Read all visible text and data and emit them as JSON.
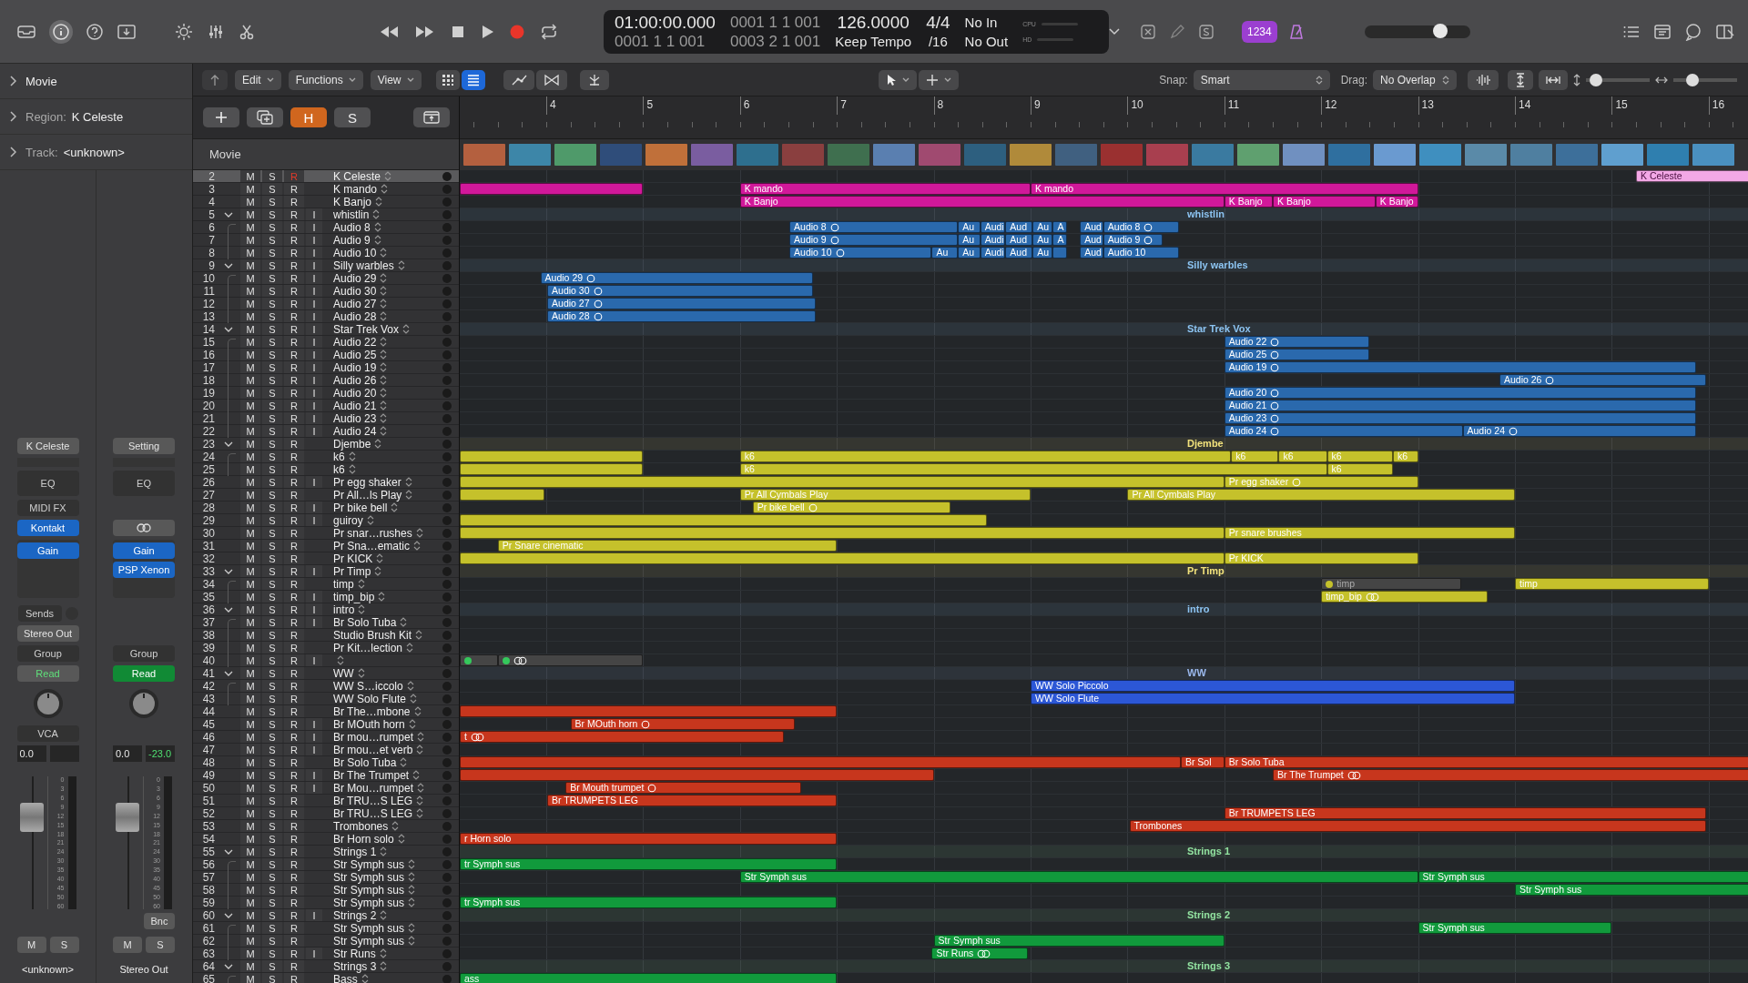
{
  "top_bar": {
    "inspector_button": {
      "selected": true
    },
    "lcd": {
      "time": "01:00:00.000",
      "position_top": "0001 1 1 001",
      "position": "0001 1 1 001",
      "length": "0003 2 1 001",
      "tempo": "126.0000",
      "tempo_mode": "Keep Tempo",
      "signature": "4/4",
      "division": "/16",
      "midi_in": "No In",
      "midi_out": "No Out",
      "cpu_label": "CPU",
      "hd_label": "HD"
    },
    "count_in": "1234",
    "master_volume": {
      "level": 0.72
    }
  },
  "toolbar": {
    "menus": [
      "Edit",
      "Functions",
      "View"
    ],
    "view_modes": [
      {
        "selected": false
      },
      {
        "selected": true
      }
    ],
    "snap_label": "Snap:",
    "snap": "Smart",
    "drag_label": "Drag:",
    "drag": "No Overlap",
    "vertical_zoom": {
      "level": 0.15
    },
    "horizontal_zoom": {
      "level": 0.3
    }
  },
  "inspector": {
    "sections": [
      {
        "label": "Movie"
      },
      {
        "label": "Region:",
        "value": "K Celeste"
      },
      {
        "label": "Track:",
        "value": "<unknown>"
      }
    ],
    "strips": [
      {
        "setting": "K Celeste",
        "eq": "EQ",
        "midi_fx": "MIDI FX",
        "plugins": [
          "Kontakt",
          "Gain"
        ],
        "sends": "Sends",
        "output": "Stereo Out",
        "group": "Group",
        "automation": "Read",
        "automation_on": false,
        "vca": "VCA",
        "volume": "0.0",
        "fader": {
          "level": 0.75
        },
        "scale": [
          "0",
          "3",
          "6",
          "9",
          "12",
          "15",
          "18",
          "21",
          "24",
          "30",
          "35",
          "40",
          "45",
          "50",
          "60"
        ],
        "mute": "M",
        "solo": "S",
        "name": "<unknown>"
      },
      {
        "setting": "Setting",
        "eq": "EQ",
        "link": true,
        "plugins": [
          "Gain",
          "PSP Xenon"
        ],
        "group": "Group",
        "automation": "Read",
        "automation_on": true,
        "volume": "0.0",
        "peak": "-23.0",
        "fader": {
          "level": 0.75
        },
        "scale": [
          "0",
          "3",
          "6",
          "9",
          "12",
          "15",
          "18",
          "21",
          "24",
          "30",
          "35",
          "40",
          "45",
          "50",
          "60"
        ],
        "bounce": "Bnc",
        "mute": "M",
        "solo": "S",
        "name": "Stereo Out"
      }
    ]
  },
  "track_list": {
    "buttons": [
      {
        "label": "H",
        "selected": true
      },
      {
        "label": "S",
        "selected": false
      }
    ],
    "movie_label": "Movie"
  },
  "ruler": [
    "4",
    "5",
    "6",
    "7",
    "8",
    "9",
    "10",
    "11",
    "12",
    "13",
    "14",
    "15",
    "16"
  ],
  "tracks": [
    {
      "number": "2",
      "name": "K Celeste",
      "kind": "track",
      "buttons": [
        "M",
        "S",
        "R"
      ],
      "armed": true,
      "selected": true,
      "color": "#f3a8e6",
      "regions": [
        {
          "label": "K Celeste",
          "muted": false
        }
      ]
    },
    {
      "number": "3",
      "name": "K mando",
      "kind": "track",
      "buttons": [
        "M",
        "S",
        "R"
      ],
      "armed": false,
      "selected": false,
      "color": "#d1189a",
      "regions": [
        {
          "muted": false
        },
        {
          "label": "K mando",
          "muted": false
        },
        {
          "label": "K mando",
          "muted": false
        }
      ]
    },
    {
      "number": "4",
      "name": "K Banjo",
      "kind": "track",
      "buttons": [
        "M",
        "S",
        "R"
      ],
      "armed": false,
      "selected": false,
      "color": "#d1189a",
      "regions": [
        {
          "label": "K Banjo",
          "muted": false
        },
        {
          "label": "K Banjo",
          "muted": false
        },
        {
          "label": "K Banjo",
          "muted": false
        },
        {
          "label": "K Banjo",
          "muted": false
        }
      ]
    },
    {
      "number": "5",
      "name": "whistlin",
      "kind": "folder",
      "expanded": true,
      "summary": "whistlin",
      "buttons": [
        "M",
        "S",
        "R",
        "I"
      ],
      "armed": false,
      "selected": false,
      "color": "#8cc4f2",
      "children": [
        {
          "number": "6",
          "name": "Audio 8",
          "kind": "track",
          "buttons": [
            "M",
            "S",
            "R",
            "I"
          ],
          "armed": false,
          "selected": false,
          "color": "#2a69ad",
          "regions": [
            {
              "label": "Audio 8",
              "kind": "ring",
              "muted": false
            },
            {
              "label": "Au",
              "muted": false
            },
            {
              "label": "Audi",
              "muted": false
            },
            {
              "label": "Aud",
              "muted": false
            },
            {
              "label": "Au",
              "muted": false
            },
            {
              "label": "A",
              "muted": false
            },
            {
              "label": "Aud",
              "muted": false
            },
            {
              "label": "Audio 8",
              "kind": "ring",
              "muted": false
            }
          ]
        },
        {
          "number": "7",
          "name": "Audio 9",
          "kind": "track",
          "buttons": [
            "M",
            "S",
            "R",
            "I"
          ],
          "armed": false,
          "selected": false,
          "color": "#2a69ad",
          "regions": [
            {
              "label": "Audio 9",
              "kind": "ring",
              "muted": false
            },
            {
              "label": "Au",
              "muted": false
            },
            {
              "label": "Audi",
              "muted": false
            },
            {
              "label": "Aud",
              "muted": false
            },
            {
              "label": "Au",
              "muted": false
            },
            {
              "label": "A",
              "muted": false
            },
            {
              "label": "Aud",
              "muted": false
            },
            {
              "label": "Audio 9",
              "kind": "ring",
              "muted": false
            }
          ]
        },
        {
          "number": "8",
          "name": "Audio 10",
          "kind": "track",
          "buttons": [
            "M",
            "S",
            "R",
            "I"
          ],
          "armed": false,
          "selected": false,
          "color": "#2a69ad",
          "regions": [
            {
              "label": "Audio 10",
              "kind": "ring",
              "muted": false
            },
            {
              "label": "Au",
              "muted": false
            },
            {
              "label": "Au",
              "muted": false
            },
            {
              "label": "Audi",
              "muted": false
            },
            {
              "label": "Aud",
              "muted": false
            },
            {
              "label": "Au",
              "muted": false
            },
            {
              "muted": false
            },
            {
              "label": "Aud",
              "muted": false
            },
            {
              "label": "Audio 10",
              "muted": false
            }
          ]
        }
      ]
    },
    {
      "number": "9",
      "name": "Silly warbles",
      "kind": "folder",
      "expanded": true,
      "summary": "Silly warbles",
      "buttons": [
        "M",
        "S",
        "R",
        "I"
      ],
      "armed": false,
      "selected": false,
      "color": "#8cc4f2",
      "children": [
        {
          "number": "10",
          "name": "Audio 29",
          "kind": "track",
          "buttons": [
            "M",
            "S",
            "R",
            "I"
          ],
          "armed": false,
          "selected": false,
          "color": "#2a69ad",
          "regions": [
            {
              "label": "Audio 29",
              "kind": "ring",
              "muted": false
            }
          ]
        },
        {
          "number": "11",
          "name": "Audio 30",
          "kind": "track",
          "buttons": [
            "M",
            "S",
            "R",
            "I"
          ],
          "armed": false,
          "selected": false,
          "color": "#2a69ad",
          "regions": [
            {
              "label": "Audio 30",
              "kind": "ring",
              "muted": false
            }
          ]
        },
        {
          "number": "12",
          "name": "Audio 27",
          "kind": "track",
          "buttons": [
            "M",
            "S",
            "R",
            "I"
          ],
          "armed": false,
          "selected": false,
          "color": "#2a69ad",
          "regions": [
            {
              "label": "Audio 27",
              "kind": "ring",
              "muted": false
            }
          ]
        },
        {
          "number": "13",
          "name": "Audio 28",
          "kind": "track",
          "buttons": [
            "M",
            "S",
            "R",
            "I"
          ],
          "armed": false,
          "selected": false,
          "color": "#2a69ad",
          "regions": [
            {
              "label": "Audio 28",
              "kind": "ring",
              "muted": false
            }
          ]
        }
      ]
    },
    {
      "number": "14",
      "name": "Star Trek Vox",
      "kind": "folder",
      "expanded": true,
      "summary": "Star Trek Vox",
      "buttons": [
        "M",
        "S",
        "R",
        "I"
      ],
      "armed": false,
      "selected": false,
      "color": "#8cc4f2",
      "children": [
        {
          "number": "15",
          "name": "Audio 22",
          "kind": "track",
          "buttons": [
            "M",
            "S",
            "R",
            "I"
          ],
          "armed": false,
          "selected": false,
          "color": "#2a69ad",
          "regions": [
            {
              "label": "Audio 22",
              "kind": "ring",
              "muted": false
            }
          ]
        },
        {
          "number": "16",
          "name": "Audio 25",
          "kind": "track",
          "buttons": [
            "M",
            "S",
            "R",
            "I"
          ],
          "armed": false,
          "selected": false,
          "color": "#2a69ad",
          "regions": [
            {
              "label": "Audio 25",
              "kind": "ring",
              "muted": false
            }
          ]
        },
        {
          "number": "17",
          "name": "Audio 19",
          "kind": "track",
          "buttons": [
            "M",
            "S",
            "R",
            "I"
          ],
          "armed": false,
          "selected": false,
          "color": "#2a69ad",
          "regions": [
            {
              "label": "Audio 19",
              "kind": "ring",
              "muted": false
            }
          ]
        },
        {
          "number": "18",
          "name": "Audio 26",
          "kind": "track",
          "buttons": [
            "M",
            "S",
            "R",
            "I"
          ],
          "armed": false,
          "selected": false,
          "color": "#2a69ad",
          "regions": [
            {
              "label": "Audio 26",
              "kind": "ring",
              "muted": false
            }
          ]
        },
        {
          "number": "19",
          "name": "Audio 20",
          "kind": "track",
          "buttons": [
            "M",
            "S",
            "R",
            "I"
          ],
          "armed": false,
          "selected": false,
          "color": "#2a69ad",
          "regions": [
            {
              "label": "Audio 20",
              "kind": "ring",
              "muted": false
            }
          ]
        },
        {
          "number": "20",
          "name": "Audio 21",
          "kind": "track",
          "buttons": [
            "M",
            "S",
            "R",
            "I"
          ],
          "armed": false,
          "selected": false,
          "color": "#2a69ad",
          "regions": [
            {
              "label": "Audio 21",
              "kind": "ring",
              "muted": false
            }
          ]
        },
        {
          "number": "21",
          "name": "Audio 23",
          "kind": "track",
          "buttons": [
            "M",
            "S",
            "R",
            "I"
          ],
          "armed": false,
          "selected": false,
          "color": "#2a69ad",
          "regions": [
            {
              "label": "Audio 23",
              "kind": "ring",
              "muted": false
            }
          ]
        },
        {
          "number": "22",
          "name": "Audio 24",
          "kind": "track",
          "buttons": [
            "M",
            "S",
            "R",
            "I"
          ],
          "armed": false,
          "selected": false,
          "color": "#2a69ad",
          "regions": [
            {
              "label": "Audio 24",
              "kind": "ring",
              "muted": false
            },
            {
              "label": "Audio 24",
              "kind": "ring",
              "muted": false
            }
          ]
        }
      ]
    },
    {
      "number": "23",
      "name": "Djembe",
      "kind": "folder",
      "expanded": true,
      "summary": "Djembe",
      "buttons": [
        "M",
        "S",
        "R"
      ],
      "armed": false,
      "selected": false,
      "color": "#f2e27c",
      "children": [
        {
          "number": "24",
          "name": "k6",
          "kind": "track",
          "buttons": [
            "M",
            "S",
            "R"
          ],
          "armed": false,
          "selected": false,
          "color": "#c5c12b",
          "regions": [
            {
              "muted": false
            },
            {
              "label": "k6",
              "muted": false
            },
            {
              "label": "k6",
              "muted": false
            },
            {
              "label": "k6",
              "muted": false
            },
            {
              "label": "k6",
              "muted": false
            },
            {
              "label": "k6",
              "muted": false
            }
          ]
        },
        {
          "number": "25",
          "name": "k6",
          "kind": "track",
          "buttons": [
            "M",
            "S",
            "R"
          ],
          "armed": false,
          "selected": false,
          "color": "#c5c12b",
          "regions": [
            {
              "muted": false
            },
            {
              "label": "k6",
              "muted": false
            },
            {
              "label": "k6",
              "muted": false
            }
          ]
        }
      ]
    },
    {
      "number": "26",
      "name": "Pr egg shaker",
      "kind": "track",
      "buttons": [
        "M",
        "S",
        "R",
        "I"
      ],
      "armed": false,
      "selected": false,
      "color": "#c5c12b",
      "regions": [
        {
          "muted": false
        },
        {
          "label": "Pr egg shaker",
          "kind": "ring",
          "muted": false
        }
      ]
    },
    {
      "number": "27",
      "name": "Pr All…ls Play",
      "kind": "track",
      "buttons": [
        "M",
        "S",
        "R"
      ],
      "armed": false,
      "selected": false,
      "color": "#c5c12b",
      "regions": [
        {
          "muted": false
        },
        {
          "label": "Pr All Cymbals Play",
          "muted": false
        },
        {
          "label": "Pr All Cymbals Play",
          "muted": false
        }
      ]
    },
    {
      "number": "28",
      "name": "Pr bike bell",
      "kind": "track",
      "buttons": [
        "M",
        "S",
        "R",
        "I"
      ],
      "armed": false,
      "selected": false,
      "color": "#c5c12b",
      "regions": [
        {
          "label": "Pr bike bell",
          "kind": "ring",
          "muted": false
        }
      ]
    },
    {
      "number": "29",
      "name": "guiroy",
      "kind": "track",
      "buttons": [
        "M",
        "S",
        "R",
        "I"
      ],
      "armed": false,
      "selected": false,
      "color": "#c5c12b",
      "regions": [
        {
          "muted": false
        }
      ]
    },
    {
      "number": "30",
      "name": "Pr snar…rushes",
      "kind": "track",
      "buttons": [
        "M",
        "S",
        "R"
      ],
      "armed": false,
      "selected": false,
      "color": "#c5c12b",
      "regions": [
        {
          "muted": false
        },
        {
          "label": "Pr snare brushes",
          "muted": false
        }
      ]
    },
    {
      "number": "31",
      "name": "Pr Sna…ematic",
      "kind": "track",
      "buttons": [
        "M",
        "S",
        "R"
      ],
      "armed": false,
      "selected": false,
      "color": "#c5c12b",
      "regions": [
        {
          "label": "Pr Snare cinematic",
          "muted": false
        }
      ]
    },
    {
      "number": "32",
      "name": "Pr KICK",
      "kind": "track",
      "buttons": [
        "M",
        "S",
        "R"
      ],
      "armed": false,
      "selected": false,
      "color": "#c5c12b",
      "regions": [
        {
          "muted": false
        },
        {
          "label": "Pr KICK",
          "muted": false
        }
      ]
    },
    {
      "number": "33",
      "name": "Pr Timp",
      "kind": "folder",
      "expanded": true,
      "summary": "Pr Timp",
      "buttons": [
        "M",
        "S",
        "R",
        "I"
      ],
      "armed": false,
      "selected": false,
      "color": "#f2e27c",
      "children": [
        {
          "number": "34",
          "name": "timp",
          "kind": "track",
          "buttons": [
            "M",
            "S",
            "R"
          ],
          "armed": false,
          "selected": false,
          "color": "#c5c12b",
          "regions": [
            {
              "label": "timp",
              "muted": true
            },
            {
              "label": "timp",
              "muted": false
            }
          ]
        },
        {
          "number": "35",
          "name": "timp_bip",
          "kind": "track",
          "buttons": [
            "M",
            "S",
            "R",
            "I"
          ],
          "armed": false,
          "selected": false,
          "color": "#c5c12b",
          "regions": [
            {
              "label": "timp_bip",
              "kind": "rings",
              "muted": false
            }
          ]
        }
      ]
    },
    {
      "number": "36",
      "name": "intro",
      "kind": "folder",
      "expanded": true,
      "summary": "intro",
      "buttons": [
        "M",
        "S",
        "R",
        "I"
      ],
      "armed": false,
      "selected": false,
      "color": "#8cc4f2",
      "children": [
        {
          "number": "37",
          "name": "Br Solo Tuba",
          "kind": "track",
          "buttons": [
            "M",
            "S",
            "R",
            "I"
          ],
          "armed": false,
          "selected": false
        },
        {
          "number": "38",
          "name": "Studio Brush Kit",
          "kind": "track",
          "buttons": [
            "M",
            "S",
            "R"
          ],
          "armed": false,
          "selected": false
        },
        {
          "number": "39",
          "name": "Pr Kit…lection",
          "kind": "track",
          "buttons": [
            "M",
            "S",
            "R"
          ],
          "armed": false,
          "selected": false
        },
        {
          "number": "40",
          "kind": "track",
          "buttons": [
            "M",
            "S",
            "R",
            "I"
          ],
          "armed": false,
          "selected": false,
          "color": "#35c85c",
          "regions": [
            {
              "muted": true
            },
            {
              "kind": "rings",
              "muted": true
            }
          ]
        }
      ]
    },
    {
      "number": "41",
      "name": "WW",
      "kind": "folder",
      "expanded": true,
      "summary": "WW",
      "buttons": [
        "M",
        "S",
        "R"
      ],
      "armed": false,
      "selected": false,
      "color": "#9ab8ec",
      "children": [
        {
          "number": "42",
          "name": "WW S…iccolo",
          "kind": "track",
          "buttons": [
            "M",
            "S",
            "R"
          ],
          "armed": false,
          "selected": false,
          "color": "#2c57d6",
          "regions": [
            {
              "label": "WW Solo Piccolo",
              "muted": false
            }
          ]
        },
        {
          "number": "43",
          "name": "WW Solo Flute",
          "kind": "track",
          "buttons": [
            "M",
            "S",
            "R"
          ],
          "armed": false,
          "selected": false,
          "color": "#2c57d6",
          "regions": [
            {
              "label": "WW Solo Flute",
              "muted": false
            }
          ]
        }
      ]
    },
    {
      "number": "44",
      "name": "Br The…mbone",
      "kind": "track",
      "buttons": [
        "M",
        "S",
        "R"
      ],
      "armed": false,
      "selected": false,
      "color": "#c7361d",
      "regions": [
        {
          "muted": false
        }
      ]
    },
    {
      "number": "45",
      "name": "Br MOuth horn",
      "kind": "track",
      "buttons": [
        "M",
        "S",
        "R",
        "I"
      ],
      "armed": false,
      "selected": false,
      "color": "#c7361d",
      "regions": [
        {
          "label": "Br MOuth horn",
          "kind": "ring",
          "muted": false
        }
      ]
    },
    {
      "number": "46",
      "name": "Br mou…rumpet",
      "kind": "track",
      "buttons": [
        "M",
        "S",
        "R",
        "I"
      ],
      "armed": false,
      "selected": false,
      "color": "#c7361d",
      "regions": [
        {
          "label": "t",
          "kind": "rings",
          "muted": false
        }
      ]
    },
    {
      "number": "47",
      "name": "Br mou…et verb",
      "kind": "track",
      "buttons": [
        "M",
        "S",
        "R",
        "I"
      ],
      "armed": false,
      "selected": false
    },
    {
      "number": "48",
      "name": "Br Solo Tuba",
      "kind": "track",
      "buttons": [
        "M",
        "S",
        "R"
      ],
      "armed": false,
      "selected": false,
      "color": "#c7361d",
      "regions": [
        {
          "muted": false
        },
        {
          "label": "Br Sol",
          "muted": false
        },
        {
          "label": "Br Solo Tuba",
          "muted": false
        }
      ]
    },
    {
      "number": "49",
      "name": "Br The Trumpet",
      "kind": "track",
      "buttons": [
        "M",
        "S",
        "R",
        "I"
      ],
      "armed": false,
      "selected": false,
      "color": "#c7361d",
      "regions": [
        {
          "muted": false
        },
        {
          "label": "Br The Trumpet",
          "kind": "rings",
          "muted": false
        }
      ]
    },
    {
      "number": "50",
      "name": "Br Mou…rumpet",
      "kind": "track",
      "buttons": [
        "M",
        "S",
        "R",
        "I"
      ],
      "armed": false,
      "selected": false,
      "color": "#c7361d",
      "regions": [
        {
          "label": "Br Mouth trumpet",
          "kind": "ring",
          "muted": false
        }
      ]
    },
    {
      "number": "51",
      "name": "Br TRU…S LEG",
      "kind": "track",
      "buttons": [
        "M",
        "S",
        "R"
      ],
      "armed": false,
      "selected": false,
      "color": "#c7361d",
      "regions": [
        {
          "label": "Br TRUMPETS LEG",
          "muted": false
        }
      ]
    },
    {
      "number": "52",
      "name": "Br TRU…S LEG",
      "kind": "track",
      "buttons": [
        "M",
        "S",
        "R"
      ],
      "armed": false,
      "selected": false,
      "color": "#c7361d",
      "regions": [
        {
          "label": "Br TRUMPETS LEG",
          "muted": false
        }
      ]
    },
    {
      "number": "53",
      "name": "Trombones",
      "kind": "track",
      "buttons": [
        "M",
        "S",
        "R"
      ],
      "armed": false,
      "selected": false,
      "color": "#c7361d",
      "regions": [
        {
          "label": "Trombones",
          "muted": false
        }
      ]
    },
    {
      "number": "54",
      "name": "Br Horn solo",
      "kind": "track",
      "buttons": [
        "M",
        "S",
        "R"
      ],
      "armed": false,
      "selected": false,
      "color": "#c7361d",
      "regions": [
        {
          "label": "r Horn solo",
          "muted": false
        }
      ]
    },
    {
      "number": "55",
      "name": "Strings 1",
      "kind": "folder",
      "expanded": true,
      "summary": "Strings 1",
      "buttons": [
        "M",
        "S",
        "R"
      ],
      "armed": false,
      "selected": false,
      "color": "#92e2a0",
      "children": [
        {
          "number": "56",
          "name": "Str Symph sus",
          "kind": "track",
          "buttons": [
            "M",
            "S",
            "R"
          ],
          "armed": false,
          "selected": false,
          "color": "#119a3c",
          "regions": [
            {
              "label": "tr Symph sus",
              "muted": false
            }
          ]
        },
        {
          "number": "57",
          "name": "Str Symph sus",
          "kind": "track",
          "buttons": [
            "M",
            "S",
            "R"
          ],
          "armed": false,
          "selected": false,
          "color": "#119a3c",
          "regions": [
            {
              "label": "Str Symph sus",
              "muted": false
            },
            {
              "label": "Str Symph sus",
              "muted": false
            }
          ]
        },
        {
          "number": "58",
          "name": "Str Symph sus",
          "kind": "track",
          "buttons": [
            "M",
            "S",
            "R"
          ],
          "armed": false,
          "selected": false,
          "color": "#119a3c",
          "regions": [
            {
              "label": "Str Symph sus",
              "muted": false
            }
          ]
        },
        {
          "number": "59",
          "name": "Str Symph sus",
          "kind": "track",
          "buttons": [
            "M",
            "S",
            "R"
          ],
          "armed": false,
          "selected": false,
          "color": "#119a3c",
          "regions": [
            {
              "label": "tr Symph sus",
              "muted": false
            }
          ]
        }
      ]
    },
    {
      "number": "60",
      "name": "Strings 2",
      "kind": "folder",
      "expanded": true,
      "summary": "Strings 2",
      "buttons": [
        "M",
        "S",
        "R",
        "I"
      ],
      "armed": false,
      "selected": false,
      "color": "#92e2a0",
      "children": [
        {
          "number": "61",
          "name": "Str Symph sus",
          "kind": "track",
          "buttons": [
            "M",
            "S",
            "R"
          ],
          "armed": false,
          "selected": false,
          "color": "#119a3c",
          "regions": [
            {
              "label": "Str Symph sus",
              "muted": false
            }
          ]
        },
        {
          "number": "62",
          "name": "Str Symph sus",
          "kind": "track",
          "buttons": [
            "M",
            "S",
            "R"
          ],
          "armed": false,
          "selected": false,
          "color": "#119a3c",
          "regions": [
            {
              "label": "Str Symph sus",
              "muted": false
            }
          ]
        },
        {
          "number": "63",
          "name": "Str Runs",
          "kind": "track",
          "buttons": [
            "M",
            "S",
            "R",
            "I"
          ],
          "armed": false,
          "selected": false,
          "color": "#119a3c",
          "regions": [
            {
              "label": "Str Runs",
              "kind": "rings",
              "muted": false
            }
          ]
        }
      ]
    },
    {
      "number": "64",
      "name": "Strings 3",
      "kind": "folder",
      "expanded": true,
      "summary": "Strings 3",
      "buttons": [
        "M",
        "S",
        "R"
      ],
      "armed": false,
      "selected": false,
      "color": "#92e2a0",
      "children": [
        {
          "number": "65",
          "name": "Bass",
          "kind": "track",
          "buttons": [
            "M",
            "S",
            "R"
          ],
          "armed": false,
          "selected": false,
          "color": "#119a3c",
          "regions": [
            {
              "label": "ass",
              "muted": false
            }
          ]
        }
      ]
    }
  ]
}
